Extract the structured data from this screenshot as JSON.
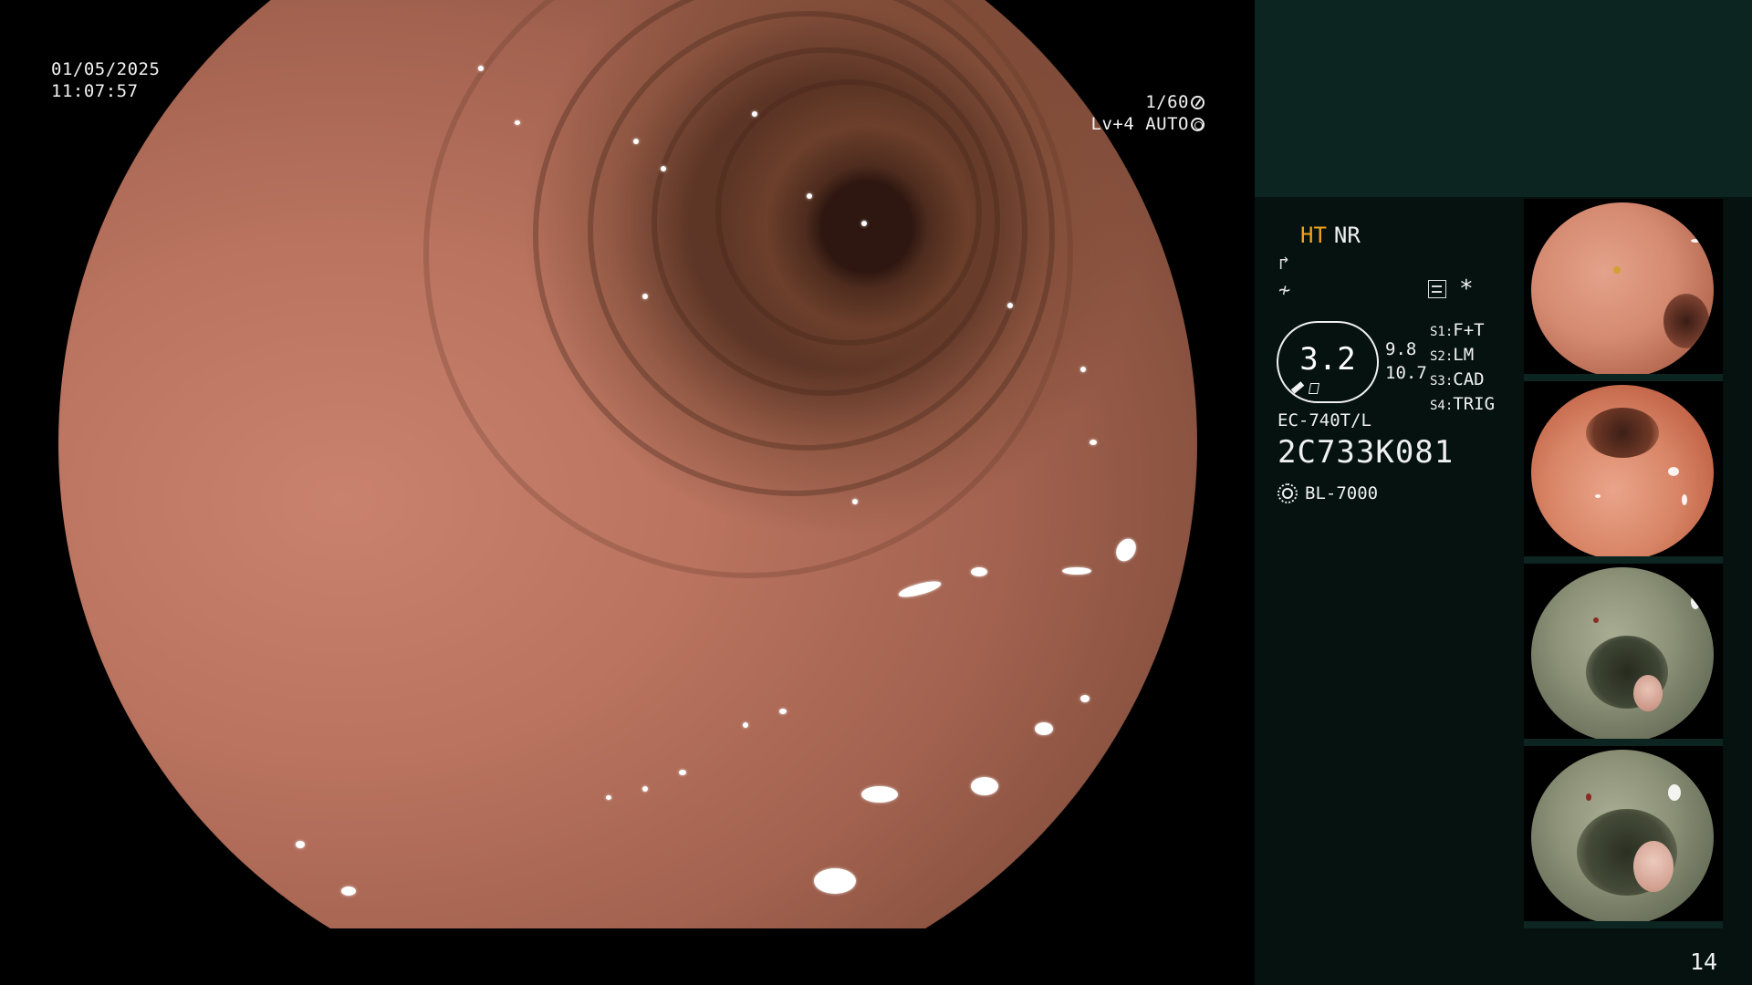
{
  "main_view": {
    "date": "01/05/2025",
    "time": "11:07:57",
    "shutter": "1/60",
    "iris": "Lv+4 AUTO"
  },
  "icons": {
    "shutter": "shutter-icon",
    "iris": "iris-icon",
    "settings": "settings-list-icon",
    "light": "light-source-icon"
  },
  "panel": {
    "ht": "HT",
    "nr": "NR",
    "icon_a": "↱",
    "icon_f": "≁",
    "asterisk": "*",
    "gauge_value": "3.2",
    "metric_1": "9.8",
    "metric_2": "10.7",
    "presets": [
      {
        "key": "S1:",
        "value": "F+T"
      },
      {
        "key": "S2:",
        "value": "LM"
      },
      {
        "key": "S3:",
        "value": "CAD"
      },
      {
        "key": "S4:",
        "value": "TRIG"
      }
    ],
    "scope_model": "EC-740T/L",
    "scope_serial": "2C733K081",
    "light_source": "BL-7000"
  },
  "page_number": "14",
  "colors": {
    "ht_accent": "#f3a21a",
    "panel_header": "#0c2521",
    "panel_body": "#051210"
  }
}
